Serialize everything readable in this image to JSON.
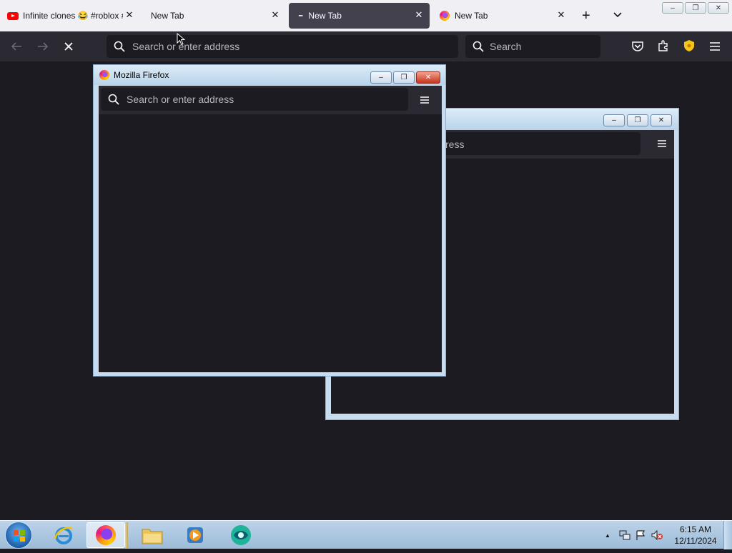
{
  "browser": {
    "tabs": [
      {
        "label": "Infinite clones 😂 #roblox #",
        "icon": "youtube-icon",
        "active": false
      },
      {
        "label": "New Tab",
        "icon": "none",
        "active": false
      },
      {
        "label": "New Tab",
        "icon": "loading-icon",
        "active": true
      },
      {
        "label": "New Tab",
        "icon": "firefox-icon",
        "active": false
      }
    ],
    "new_tab_symbol": "+",
    "url_placeholder": "Search or enter address",
    "search_placeholder": "Search",
    "window_controls": {
      "minimize": "–",
      "restore": "❐",
      "close": "✕"
    }
  },
  "clone_windows": {
    "front": {
      "title": "Mozilla Firefox",
      "url_placeholder": "Search or enter address"
    },
    "back": {
      "url_partial": "ress"
    }
  },
  "taskbar": {
    "time": "6:15 AM",
    "date": "12/11/2024",
    "tray_arrow": "▲"
  },
  "colors": {
    "accent": "#42414d",
    "content_bg": "#1c1b22",
    "toolbar_bg": "#2b2a33",
    "tabstrip_bg": "#f0f0f4"
  }
}
